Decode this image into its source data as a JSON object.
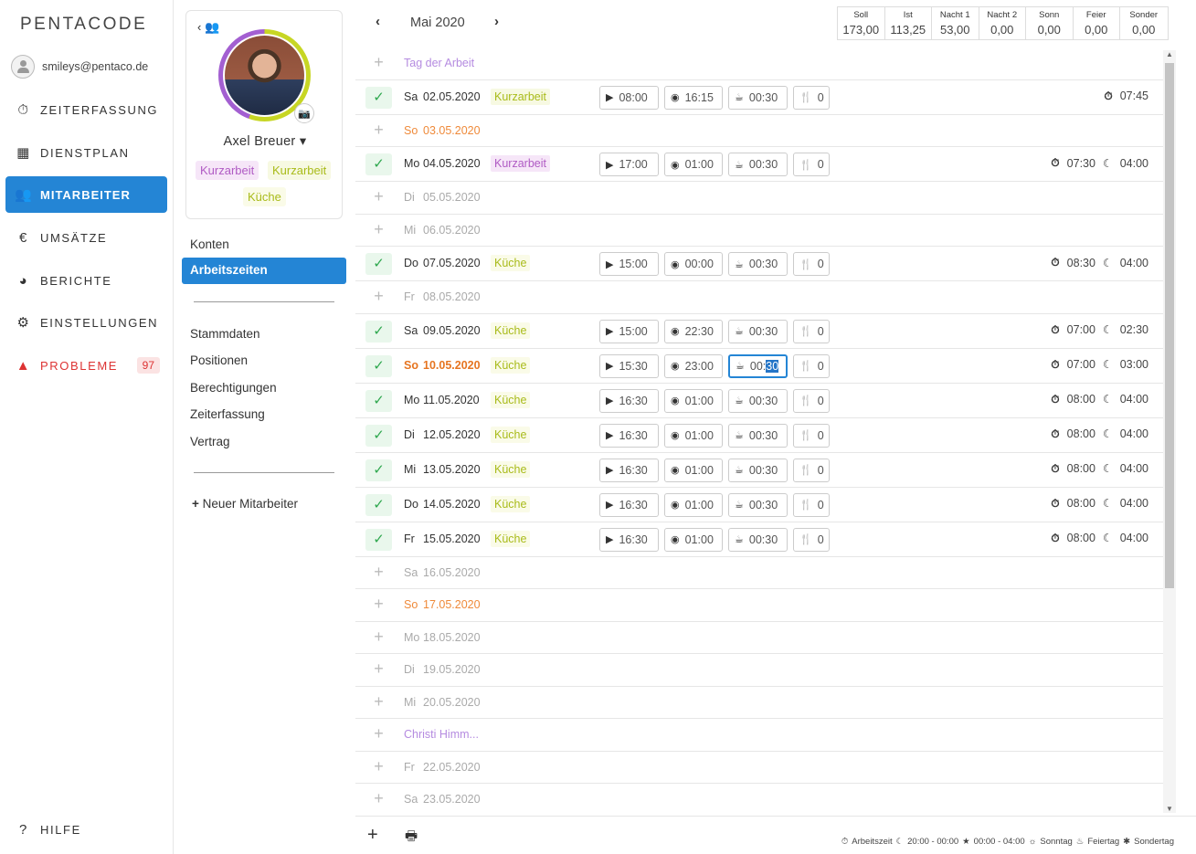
{
  "brand": "PENTACODE",
  "user": {
    "email": "smileys@pentaco.de"
  },
  "nav": [
    {
      "id": "zeiterfassung",
      "label": "ZEITERFASSUNG",
      "icon": "stopwatch-icon"
    },
    {
      "id": "dienstplan",
      "label": "DIENSTPLAN",
      "icon": "table-icon"
    },
    {
      "id": "mitarbeiter",
      "label": "MITARBEITER",
      "icon": "users-icon",
      "active": true
    },
    {
      "id": "umsaetze",
      "label": "UMSÄTZE",
      "icon": "euro-icon"
    },
    {
      "id": "berichte",
      "label": "BERICHTE",
      "icon": "pie-chart-icon"
    },
    {
      "id": "einstellungen",
      "label": "EINSTELLUNGEN",
      "icon": "gear-icon"
    },
    {
      "id": "probleme",
      "label": "PROBLEME",
      "icon": "warning-icon",
      "badge": "97"
    },
    {
      "id": "hilfe",
      "label": "HILFE",
      "icon": "question-icon"
    }
  ],
  "profile": {
    "name": "Axel Breuer",
    "tags": [
      "Kurzarbeit",
      "Kurzarbeit",
      "Küche"
    ]
  },
  "submenu": {
    "konten": "Konten",
    "arbeitszeiten": "Arbeitszeiten",
    "items": [
      "Stammdaten",
      "Positionen",
      "Berechtigungen",
      "Zeiterfassung",
      "Vertrag"
    ],
    "new": "Neuer Mitarbeiter"
  },
  "month": "Mai 2020",
  "stats": [
    {
      "label": "Soll",
      "value": "173,00"
    },
    {
      "label": "Ist",
      "value": "113,25"
    },
    {
      "label": "Nacht 1",
      "value": "53,00"
    },
    {
      "label": "Nacht 2",
      "value": "0,00"
    },
    {
      "label": "Sonn",
      "value": "0,00"
    },
    {
      "label": "Feier",
      "value": "0,00"
    },
    {
      "label": "Sonder",
      "value": "0,00"
    }
  ],
  "rows": [
    {
      "type": "holiday",
      "day": "Tag der Arbeit"
    },
    {
      "type": "work",
      "wd": "Sa",
      "date": "02.05.2020",
      "tag": "Kurzarbeit",
      "tagc": "kz2",
      "start": "08:00",
      "end": "16:15",
      "pause": "00:30",
      "meal": "0",
      "dur": "07:45",
      "night": ""
    },
    {
      "type": "sun",
      "wd": "So",
      "date": "03.05.2020"
    },
    {
      "type": "work",
      "wd": "Mo",
      "date": "04.05.2020",
      "tag": "Kurzarbeit",
      "tagc": "kz",
      "start": "17:00",
      "end": "01:00",
      "pause": "00:30",
      "meal": "0",
      "dur": "07:30",
      "night": "04:00"
    },
    {
      "type": "empty",
      "wd": "Di",
      "date": "05.05.2020"
    },
    {
      "type": "empty",
      "wd": "Mi",
      "date": "06.05.2020"
    },
    {
      "type": "work",
      "wd": "Do",
      "date": "07.05.2020",
      "tag": "Küche",
      "tagc": "ku",
      "start": "15:00",
      "end": "00:00",
      "pause": "00:30",
      "meal": "0",
      "dur": "08:30",
      "night": "04:00"
    },
    {
      "type": "empty",
      "wd": "Fr",
      "date": "08.05.2020"
    },
    {
      "type": "work",
      "wd": "Sa",
      "date": "09.05.2020",
      "tag": "Küche",
      "tagc": "ku",
      "start": "15:00",
      "end": "22:30",
      "pause": "00:30",
      "meal": "0",
      "dur": "07:00",
      "night": "02:30"
    },
    {
      "type": "worksun",
      "wd": "So",
      "date": "10.05.2020",
      "tag": "Küche",
      "tagc": "ku",
      "start": "15:30",
      "end": "23:00",
      "pause": "00:30",
      "pausea": "00:",
      "pauseb": "30",
      "meal": "0",
      "dur": "07:00",
      "night": "03:00",
      "sel": true
    },
    {
      "type": "work",
      "wd": "Mo",
      "date": "11.05.2020",
      "tag": "Küche",
      "tagc": "ku",
      "start": "16:30",
      "end": "01:00",
      "pause": "00:30",
      "meal": "0",
      "dur": "08:00",
      "night": "04:00"
    },
    {
      "type": "work",
      "wd": "Di",
      "date": "12.05.2020",
      "tag": "Küche",
      "tagc": "ku",
      "start": "16:30",
      "end": "01:00",
      "pause": "00:30",
      "meal": "0",
      "dur": "08:00",
      "night": "04:00"
    },
    {
      "type": "work",
      "wd": "Mi",
      "date": "13.05.2020",
      "tag": "Küche",
      "tagc": "ku",
      "start": "16:30",
      "end": "01:00",
      "pause": "00:30",
      "meal": "0",
      "dur": "08:00",
      "night": "04:00"
    },
    {
      "type": "work",
      "wd": "Do",
      "date": "14.05.2020",
      "tag": "Küche",
      "tagc": "ku",
      "start": "16:30",
      "end": "01:00",
      "pause": "00:30",
      "meal": "0",
      "dur": "08:00",
      "night": "04:00"
    },
    {
      "type": "work",
      "wd": "Fr",
      "date": "15.05.2020",
      "tag": "Küche",
      "tagc": "ku",
      "start": "16:30",
      "end": "01:00",
      "pause": "00:30",
      "meal": "0",
      "dur": "08:00",
      "night": "04:00"
    },
    {
      "type": "empty",
      "wd": "Sa",
      "date": "16.05.2020"
    },
    {
      "type": "sun",
      "wd": "So",
      "date": "17.05.2020"
    },
    {
      "type": "empty",
      "wd": "Mo",
      "date": "18.05.2020"
    },
    {
      "type": "empty",
      "wd": "Di",
      "date": "19.05.2020"
    },
    {
      "type": "empty",
      "wd": "Mi",
      "date": "20.05.2020"
    },
    {
      "type": "holiday",
      "day": "Christi Himm..."
    },
    {
      "type": "empty",
      "wd": "Fr",
      "date": "22.05.2020"
    },
    {
      "type": "empty",
      "wd": "Sa",
      "date": "23.05.2020"
    }
  ],
  "legend": {
    "arbeitszeit": "Arbeitszeit",
    "n1": "20:00 - 00:00",
    "n2": "00:00 - 04:00",
    "sonntag": "Sonntag",
    "feiertag": "Feiertag",
    "sondertag": "Sondertag"
  }
}
